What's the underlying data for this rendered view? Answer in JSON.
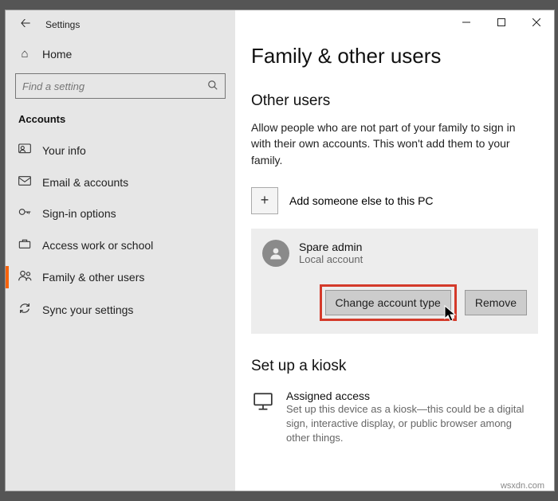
{
  "window": {
    "title": "Settings"
  },
  "sidebar": {
    "home": "Home",
    "search_placeholder": "Find a setting",
    "category": "Accounts",
    "items": [
      {
        "label": "Your info"
      },
      {
        "label": "Email & accounts"
      },
      {
        "label": "Sign-in options"
      },
      {
        "label": "Access work or school"
      },
      {
        "label": "Family & other users"
      },
      {
        "label": "Sync your settings"
      }
    ]
  },
  "main": {
    "heading": "Family & other users",
    "section_other_users": "Other users",
    "other_users_desc": "Allow people who are not part of your family to sign in with their own accounts. This won't add them to your family.",
    "add_label": "Add someone else to this PC",
    "user": {
      "name": "Spare admin",
      "sub": "Local account",
      "change_btn": "Change account type",
      "remove_btn": "Remove"
    },
    "section_kiosk": "Set up a kiosk",
    "kiosk": {
      "title": "Assigned access",
      "sub": "Set up this device as a kiosk—this could be a digital sign, interactive display, or public browser among other things."
    }
  },
  "watermark": "wsxdn.com"
}
